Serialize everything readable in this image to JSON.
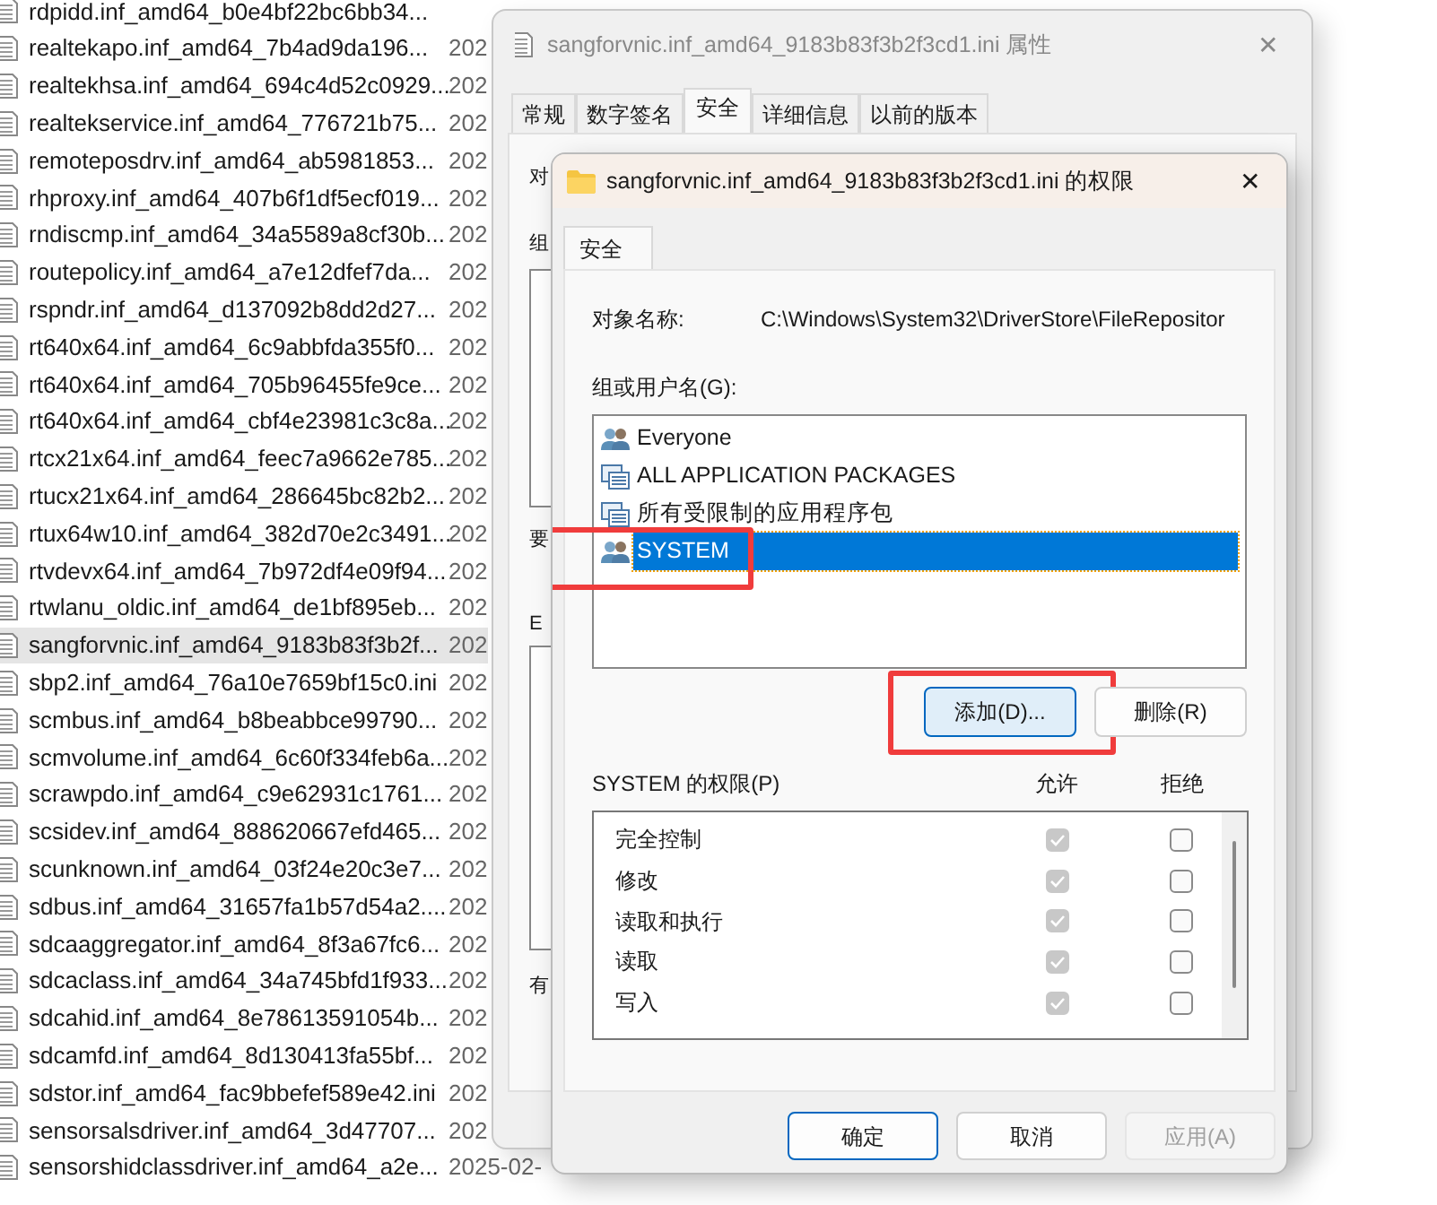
{
  "files": [
    {
      "name": "rdpidd.inf_amd64_b0e4bf22bc6bb34...",
      "selected": false
    },
    {
      "name": "realtekapo.inf_amd64_7b4ad9da196...",
      "date": "202",
      "selected": false
    },
    {
      "name": "realtekhsa.inf_amd64_694c4d52c0929...",
      "date": "202",
      "selected": false
    },
    {
      "name": "realtekservice.inf_amd64_776721b75...",
      "date": "202",
      "selected": false
    },
    {
      "name": "remoteposdrv.inf_amd64_ab5981853...",
      "date": "202",
      "selected": false
    },
    {
      "name": "rhproxy.inf_amd64_407b6f1df5ecf019...",
      "date": "202",
      "selected": false
    },
    {
      "name": "rndiscmp.inf_amd64_34a5589a8cf30b...",
      "date": "202",
      "selected": false
    },
    {
      "name": "routepolicy.inf_amd64_a7e12dfef7da...",
      "date": "202",
      "selected": false
    },
    {
      "name": "rspndr.inf_amd64_d137092b8dd2d27...",
      "date": "202",
      "selected": false
    },
    {
      "name": "rt640x64.inf_amd64_6c9abbfda355f0...",
      "date": "202",
      "selected": false
    },
    {
      "name": "rt640x64.inf_amd64_705b96455fe9ce...",
      "date": "202",
      "selected": false
    },
    {
      "name": "rt640x64.inf_amd64_cbf4e23981c3c8a...",
      "date": "202",
      "selected": false
    },
    {
      "name": "rtcx21x64.inf_amd64_feec7a9662e785...",
      "date": "202",
      "selected": false
    },
    {
      "name": "rtucx21x64.inf_amd64_286645bc82b2...",
      "date": "202",
      "selected": false
    },
    {
      "name": "rtux64w10.inf_amd64_382d70e2c3491...",
      "date": "202",
      "selected": false
    },
    {
      "name": "rtvdevx64.inf_amd64_7b972df4e09f94...",
      "date": "202",
      "selected": false
    },
    {
      "name": "rtwlanu_oldic.inf_amd64_de1bf895eb...",
      "date": "202",
      "selected": false
    },
    {
      "name": "sangforvnic.inf_amd64_9183b83f3b2f...",
      "date": "202",
      "selected": true
    },
    {
      "name": "sbp2.inf_amd64_76a10e7659bf15c0.ini",
      "date": "202",
      "selected": false
    },
    {
      "name": "scmbus.inf_amd64_b8beabbce99790...",
      "date": "202",
      "selected": false
    },
    {
      "name": "scmvolume.inf_amd64_6c60f334feb6a...",
      "date": "202",
      "selected": false
    },
    {
      "name": "scrawpdo.inf_amd64_c9e62931c1761...",
      "date": "202",
      "selected": false
    },
    {
      "name": "scsidev.inf_amd64_888620667efd465...",
      "date": "202",
      "selected": false
    },
    {
      "name": "scunknown.inf_amd64_03f24e20c3e7...",
      "date": "202",
      "selected": false
    },
    {
      "name": "sdbus.inf_amd64_31657fa1b57d54a2....",
      "date": "202",
      "selected": false
    },
    {
      "name": "sdcaaggregator.inf_amd64_8f3a67fc6...",
      "date": "202",
      "selected": false
    },
    {
      "name": "sdcaclass.inf_amd64_34a745bfd1f933...",
      "date": "202",
      "selected": false
    },
    {
      "name": "sdcahid.inf_amd64_8e78613591054b...",
      "date": "202",
      "selected": false
    },
    {
      "name": "sdcamfd.inf_amd64_8d130413fa55bf...",
      "date": "202",
      "selected": false
    },
    {
      "name": "sdstor.inf_amd64_fac9bbefef589e42.ini",
      "date": "202",
      "selected": false
    },
    {
      "name": "sensorsalsdriver.inf_amd64_3d47707...",
      "date": "202",
      "selected": false
    },
    {
      "name": "sensorshidclassdriver.inf_amd64_a2e...",
      "date": "2025-02-",
      "selected": false
    }
  ],
  "properties_dialog": {
    "title": "sangforvnic.inf_amd64_9183b83f3b2f3cd1.ini 属性",
    "close": "✕",
    "tabs": [
      {
        "label": "常规",
        "selected": false
      },
      {
        "label": "数字签名",
        "selected": false
      },
      {
        "label": "安全",
        "selected": true
      },
      {
        "label": "详细信息",
        "selected": false
      },
      {
        "label": "以前的版本",
        "selected": false
      }
    ],
    "fragments": [
      "对",
      "组",
      "要",
      "E",
      "有"
    ]
  },
  "permissions_dialog": {
    "title": "sangforvnic.inf_amd64_9183b83f3b2f3cd1.ini 的权限",
    "close": "✕",
    "tab_label": "安全",
    "object_label": "对象名称:",
    "object_path": "C:\\Windows\\System32\\DriverStore\\FileRepositor",
    "groups_label": "组或用户名(G):",
    "groups": [
      {
        "name": "Everyone",
        "kind": "users",
        "selected": false,
        "highlighted": false
      },
      {
        "name": "ALL APPLICATION PACKAGES",
        "kind": "package",
        "selected": false,
        "highlighted": false
      },
      {
        "name": "所有受限制的应用程序包",
        "kind": "package",
        "selected": false,
        "highlighted": false
      },
      {
        "name": "SYSTEM",
        "kind": "users",
        "selected": true,
        "highlighted": true
      }
    ],
    "group_buttons": [
      {
        "label": "添加(D)...",
        "focused": true,
        "highlighted": true
      },
      {
        "label": "删除(R)",
        "focused": false,
        "highlighted": false
      }
    ],
    "permissions_label": "SYSTEM 的权限(P)",
    "allow_header": "允许",
    "deny_header": "拒绝",
    "permissions": [
      {
        "name": "完全控制",
        "allow": true,
        "deny": false
      },
      {
        "name": "修改",
        "allow": true,
        "deny": false
      },
      {
        "name": "读取和执行",
        "allow": true,
        "deny": false
      },
      {
        "name": "读取",
        "allow": true,
        "deny": false
      },
      {
        "name": "写入",
        "allow": true,
        "deny": false
      }
    ],
    "buttons": [
      {
        "label": "确定",
        "default": true,
        "disabled": false
      },
      {
        "label": "取消",
        "default": false,
        "disabled": false
      },
      {
        "label": "应用(A)",
        "default": false,
        "disabled": true
      }
    ]
  }
}
